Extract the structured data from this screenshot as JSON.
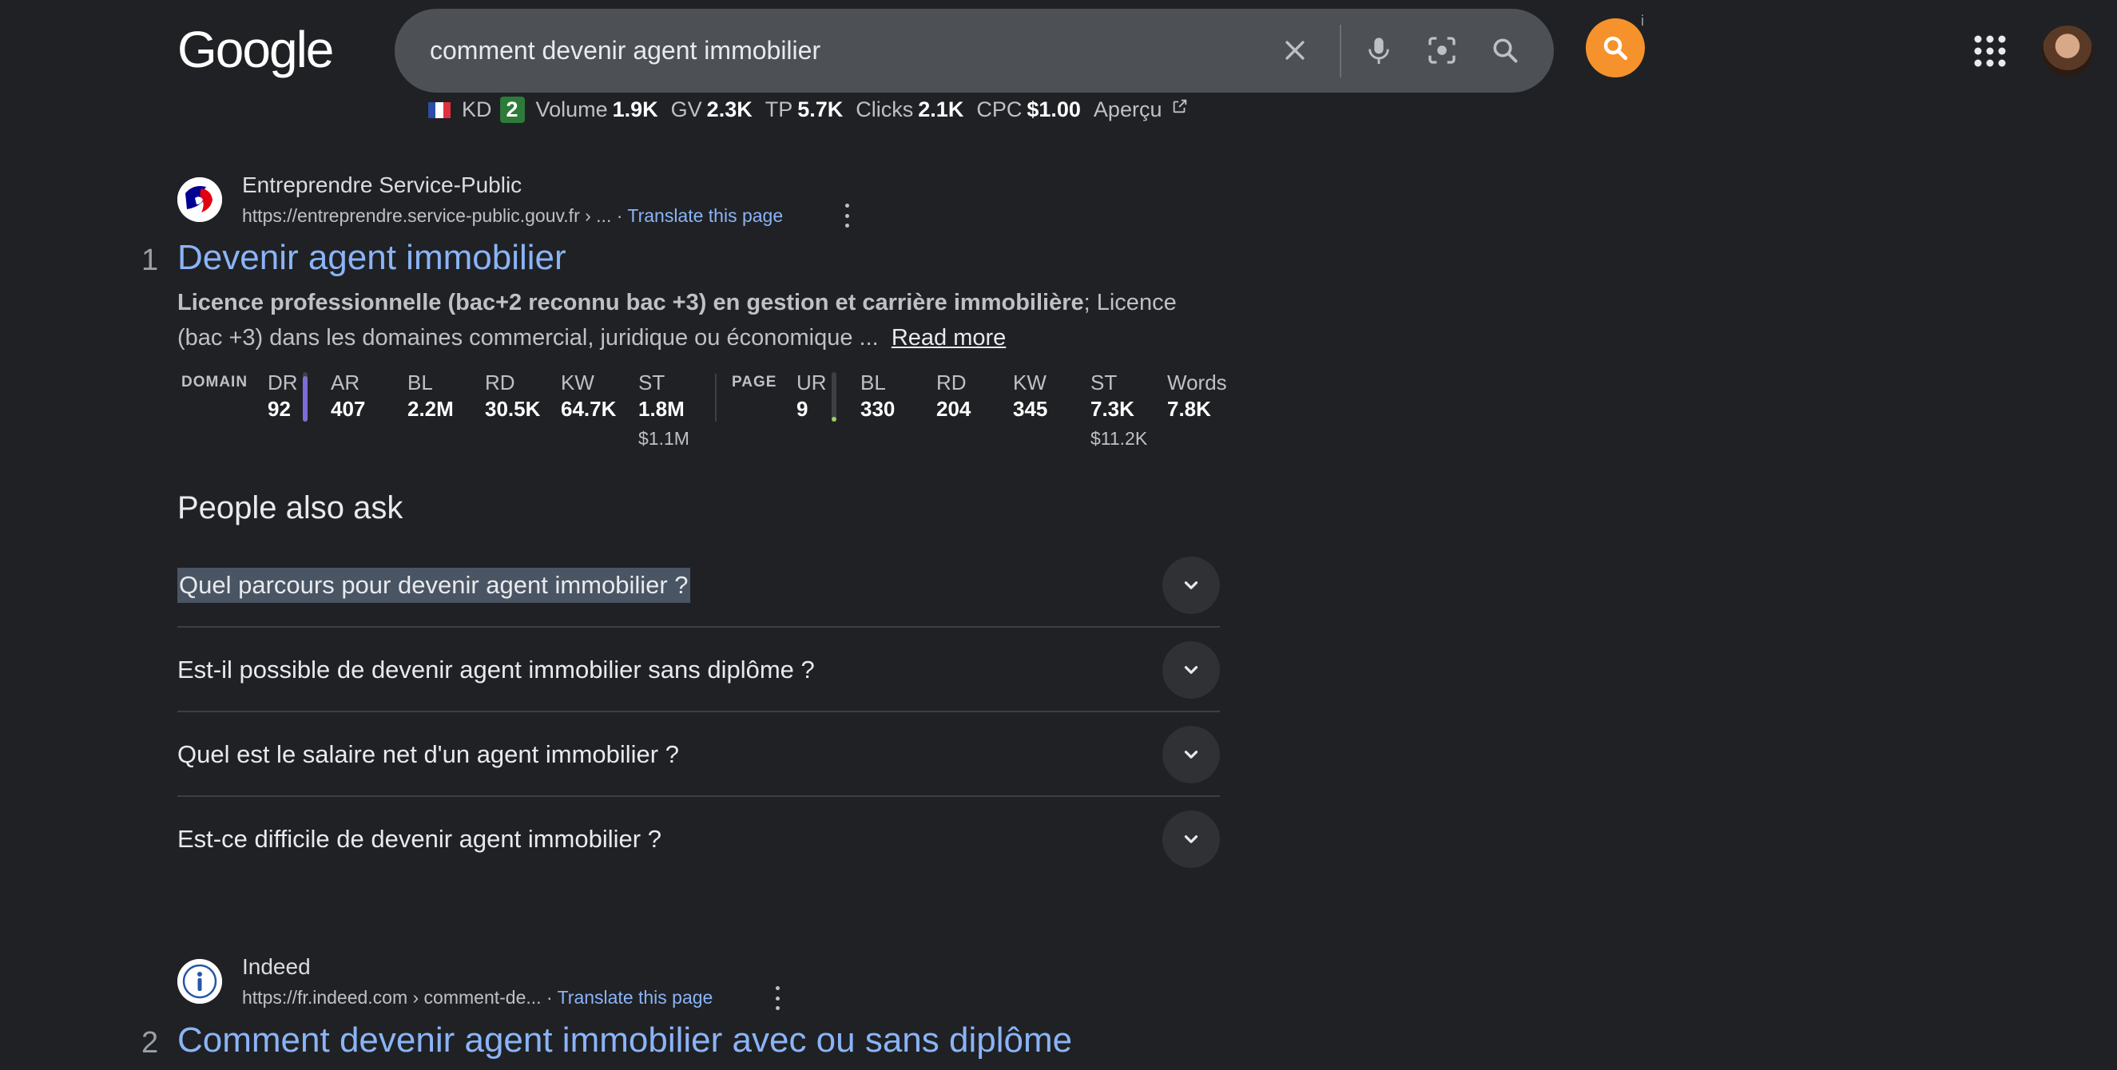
{
  "header": {
    "logo": "Google",
    "search_query": "comment devenir agent immobilier",
    "ext_info": "i"
  },
  "kdbar": {
    "kd_label": "KD",
    "kd_value": "2",
    "items": [
      {
        "label": "Volume",
        "value": "1.9K"
      },
      {
        "label": "GV",
        "value": "2.3K"
      },
      {
        "label": "TP",
        "value": "5.7K"
      },
      {
        "label": "Clicks",
        "value": "2.1K"
      },
      {
        "label": "CPC",
        "value": "$1.00"
      }
    ],
    "apercu": "Aperçu"
  },
  "results": [
    {
      "rank": "1",
      "site_name": "Entreprendre Service-Public",
      "url": "https://entreprendre.service-public.gouv.fr › ...",
      "translate": "Translate this page",
      "title": "Devenir agent immobilier",
      "snippet_bold": "Licence professionnelle (bac+2 reconnu bac +3) en gestion et carrière immobilière",
      "snippet_rest": "; Licence (bac +3) dans les domaines commercial, juridique ou économique ...",
      "read_more": "Read more"
    },
    {
      "rank": "2",
      "site_name": "Indeed",
      "url": "https://fr.indeed.com › comment-de...",
      "translate": "Translate this page",
      "title": "Comment devenir agent immobilier avec ou sans diplôme"
    }
  ],
  "metrics": {
    "domain_label": "DOMAIN",
    "page_label": "PAGE",
    "domain": [
      {
        "key": "DR",
        "value": "92"
      },
      {
        "key": "AR",
        "value": "407"
      },
      {
        "key": "BL",
        "value": "2.2M"
      },
      {
        "key": "RD",
        "value": "30.5K"
      },
      {
        "key": "KW",
        "value": "64.7K"
      },
      {
        "key": "ST",
        "value": "1.8M",
        "sub": "$1.1M"
      }
    ],
    "page": [
      {
        "key": "UR",
        "value": "9"
      },
      {
        "key": "BL",
        "value": "330"
      },
      {
        "key": "RD",
        "value": "204"
      },
      {
        "key": "KW",
        "value": "345"
      },
      {
        "key": "ST",
        "value": "7.3K",
        "sub": "$11.2K"
      },
      {
        "key": "Words",
        "value": "7.8K"
      }
    ],
    "dr_level": 0.92,
    "ur_level": 0.09
  },
  "paa": {
    "heading": "People also ask",
    "questions": [
      "Quel parcours pour devenir agent immobilier ?",
      "Est-il possible de devenir agent immobilier sans diplôme ?",
      "Quel est le salaire net d'un agent immobilier ?",
      "Est-ce difficile de devenir agent immobilier ?"
    ]
  },
  "colors": {
    "background": "#202124",
    "link": "#8ab4f8",
    "extension": "#f6922b",
    "kd_badge": "#2d7a3a",
    "dr_bar": "#7b6fd6",
    "ur_bar": "#9ccc65"
  }
}
